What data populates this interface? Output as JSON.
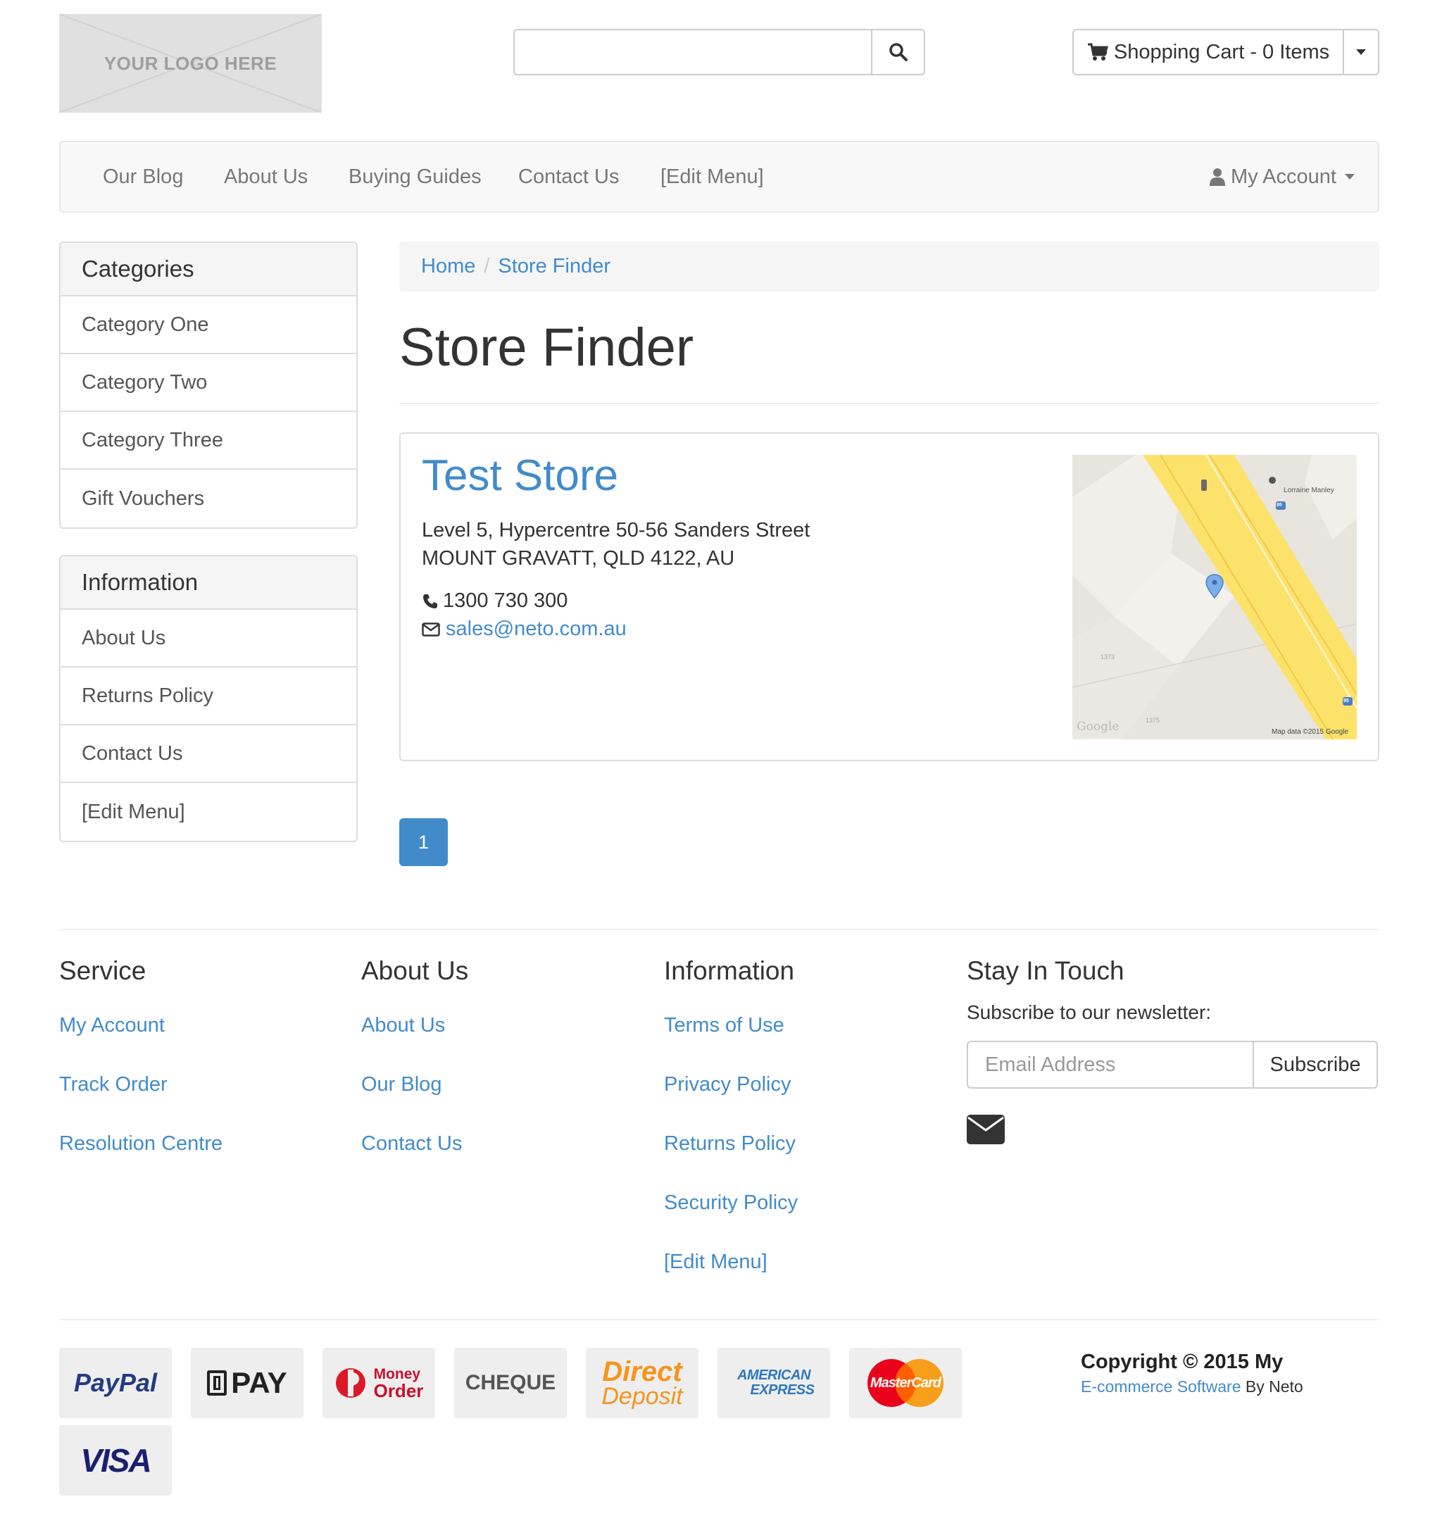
{
  "header": {
    "logo_text": "YOUR LOGO HERE",
    "search": {
      "placeholder": "",
      "value": ""
    },
    "cart_label": "Shopping Cart - 0 Items"
  },
  "nav": {
    "items": [
      "Our Blog",
      "About Us",
      "Buying Guides",
      "Contact Us",
      "[Edit Menu]"
    ],
    "account_label": "My Account"
  },
  "sidebar": {
    "categories_title": "Categories",
    "categories": [
      "Category One",
      "Category Two",
      "Category Three",
      "Gift Vouchers"
    ],
    "information_title": "Information",
    "information": [
      "About Us",
      "Returns Policy",
      "Contact Us",
      "[Edit Menu]"
    ]
  },
  "breadcrumb": [
    "Home",
    "Store Finder"
  ],
  "page_title": "Store Finder",
  "store": {
    "name": "Test Store",
    "address_line1": "Level 5, Hypercentre 50-56 Sanders Street",
    "address_line2": "MOUNT GRAVATT, QLD 4122, AU",
    "phone": "1300 730 300",
    "email": "sales@neto.com.au",
    "map": {
      "place_label": "Lorraine Manley",
      "street_number_1": "1373",
      "street_number_2": "1375",
      "road_shield": "95",
      "attribution": "Map data ©2015 Google",
      "brand": "Google"
    }
  },
  "pagination": {
    "current_page": "1"
  },
  "footer": {
    "service": {
      "title": "Service",
      "links": [
        "My Account",
        "Track Order",
        "Resolution Centre"
      ]
    },
    "about": {
      "title": "About Us",
      "links": [
        "About Us",
        "Our Blog",
        "Contact Us"
      ]
    },
    "information": {
      "title": "Information",
      "links": [
        "Terms of Use",
        "Privacy Policy",
        "Returns Policy",
        "Security Policy",
        "[Edit Menu]"
      ]
    },
    "stay": {
      "title": "Stay In Touch",
      "newsletter_label": "Subscribe to our newsletter:",
      "email_placeholder": "Email Address",
      "subscribe_label": "Subscribe"
    }
  },
  "payments": {
    "paypal": "PayPal",
    "bpay": "PAY",
    "money_order_1": "Money",
    "money_order_2": "Order",
    "cheque": "CHEQUE",
    "direct_1": "Direct",
    "direct_2": "Deposit",
    "amex_1": "AMERICAN",
    "amex_2": "EXPRESS",
    "mastercard": "MasterCard",
    "visa": "VISA"
  },
  "copyright": {
    "line1": "Copyright © 2015 My",
    "link_text": "E-commerce Software",
    "by_text": " By Neto"
  },
  "colors": {
    "link": "#428bca",
    "panel_bg": "#f5f5f5",
    "border": "#dddddd",
    "map_road": "#fce26a",
    "map_bg": "#e8e5df"
  }
}
